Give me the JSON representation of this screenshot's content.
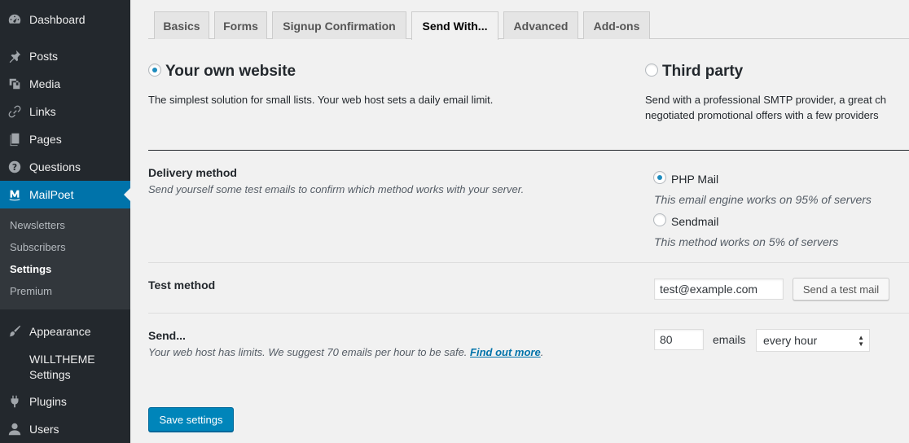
{
  "sidebar": {
    "menu": [
      {
        "label": "Dashboard",
        "icon": "dashboard-icon"
      },
      {
        "label": "Posts",
        "icon": "pin-icon"
      },
      {
        "label": "Media",
        "icon": "media-icon"
      },
      {
        "label": "Links",
        "icon": "link-icon"
      },
      {
        "label": "Pages",
        "icon": "pages-icon"
      },
      {
        "label": "Questions",
        "icon": "help-icon"
      },
      {
        "label": "MailPoet",
        "icon": "mailpoet-icon"
      }
    ],
    "submenu": [
      "Newsletters",
      "Subscribers",
      "Settings",
      "Premium"
    ],
    "menu_lower": [
      {
        "label": "Appearance",
        "icon": "brush-icon"
      },
      {
        "label_line1": "WILLTHEME",
        "label_line2": "Settings"
      },
      {
        "label": "Plugins",
        "icon": "plugin-icon"
      },
      {
        "label": "Users",
        "icon": "user-icon"
      }
    ],
    "accent": "#0073aa"
  },
  "tabs": [
    "Basics",
    "Forms",
    "Signup Confirmation",
    "Send With...",
    "Advanced",
    "Add-ons"
  ],
  "active_tab": "Send With...",
  "send_with": {
    "own": {
      "title": "Your own website",
      "description": "The simplest solution for small lists. Your web host sets a daily email limit.",
      "selected": true
    },
    "third": {
      "title": "Third party",
      "description_line1": "Send with a professional SMTP provider, a great ch",
      "description_line2": "negotiated promotional offers with a few providers"
    }
  },
  "delivery": {
    "label": "Delivery method",
    "help": "Send yourself some test emails to confirm which method works with your server.",
    "options": [
      {
        "label": "PHP Mail",
        "note": "This email engine works on 95% of servers",
        "selected": true
      },
      {
        "label": "Sendmail",
        "note": "This method works on 5% of servers",
        "selected": false
      }
    ]
  },
  "test_method": {
    "label": "Test method",
    "email_value": "test@example.com",
    "button": "Send a test mail"
  },
  "send_limit": {
    "label": "Send...",
    "help_prefix": "Your web host has limits. We suggest 70 emails per hour to be safe. ",
    "help_link": "Find out more",
    "help_suffix": ".",
    "amount": "80",
    "unit": "emails",
    "frequency": "every hour"
  },
  "save_button": "Save settings"
}
